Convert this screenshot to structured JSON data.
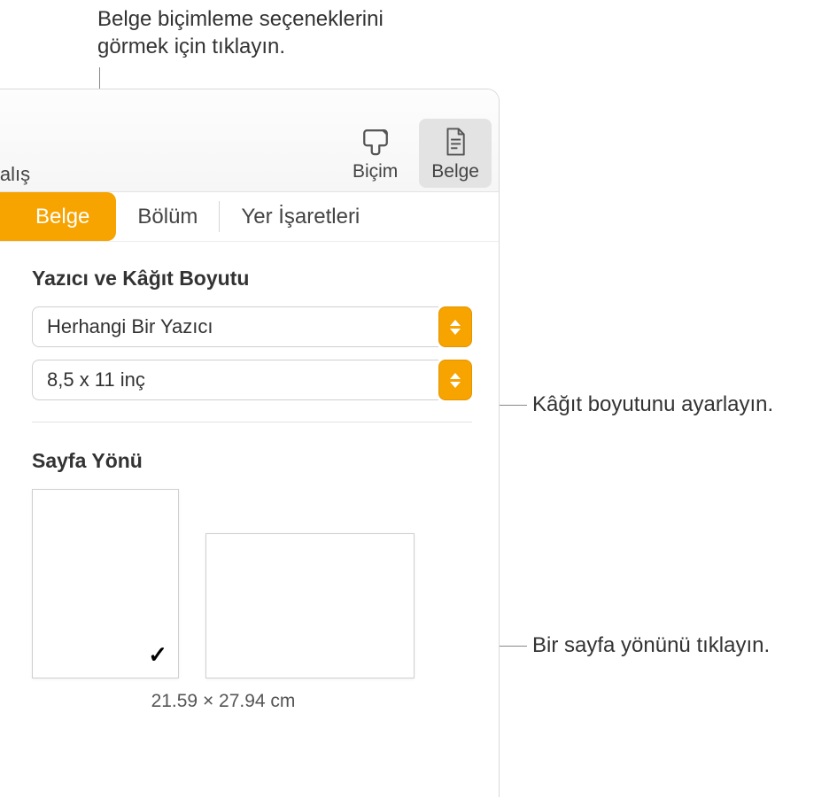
{
  "toolbar": {
    "truncated_left": "Çalış",
    "format": {
      "label": "Biçim"
    },
    "document": {
      "label": "Belge"
    }
  },
  "tabs": {
    "document": "Belge",
    "section": "Bölüm",
    "bookmarks": "Yer İşaretleri"
  },
  "printer": {
    "title": "Yazıcı ve Kâğıt Boyutu",
    "printer_value": "Herhangi Bir Yazıcı",
    "paper_value": "8,5 x 11 inç"
  },
  "orientation": {
    "title": "Sayfa Yönü",
    "dimensions": "21.59 × 27.94 cm",
    "selected": "portrait"
  },
  "callouts": {
    "top": "Belge biçimleme seçeneklerini\ngörmek için tıklayın.",
    "paper": "Kâğıt boyutunu ayarlayın.",
    "orient": "Bir sayfa yönünü tıklayın."
  },
  "colors": {
    "accent": "#f7a300"
  }
}
